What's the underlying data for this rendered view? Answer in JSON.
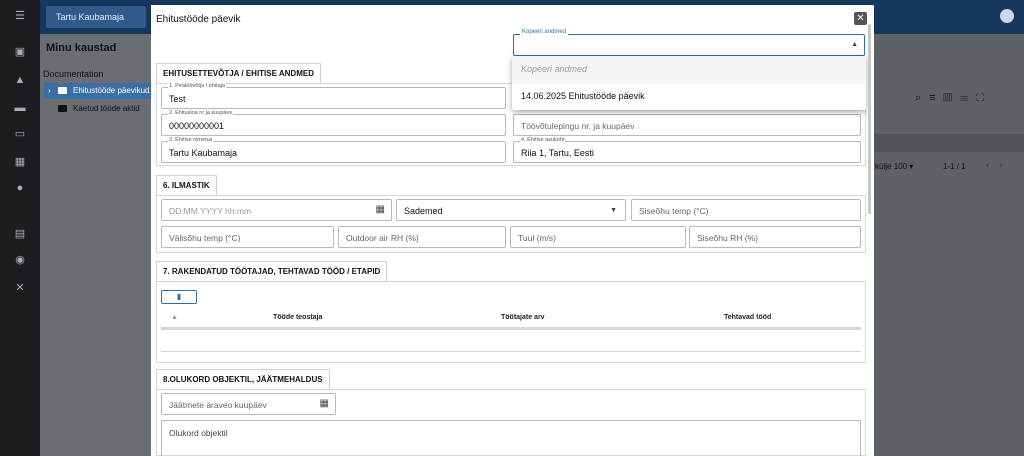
{
  "app": {
    "crumb": "Tartu Kaubamaja",
    "sidebar_icons": [
      "menu-icon",
      "dashboard-icon",
      "tools-icon",
      "folder-icon",
      "inbox-icon",
      "calculator-icon",
      "users-icon",
      "calendar-icon",
      "settings-icon",
      "wrench-icon"
    ]
  },
  "panel": {
    "title": "Minu kaustad",
    "section": "Documentation",
    "items": [
      {
        "label": "Ehitustööde päevikud",
        "active": true
      },
      {
        "label": "Kaetud tööde aktid",
        "active": false
      }
    ]
  },
  "background_grid": {
    "per_page_label": "külje",
    "per_page_value": "100 ▾",
    "range": "1-1 / 1"
  },
  "modal": {
    "title": "Ehitustööde päevik",
    "close_label": "✕",
    "copy": {
      "label": "Kopeeri andmed",
      "placeholder_option": "Kopeeri andmed",
      "options": [
        "14.06.2025 Ehitustööde päevik"
      ]
    },
    "section1": {
      "tab": "EHITUSETTEVÕTJA / EHITISE ANDMED",
      "fields": {
        "contractor": {
          "label": "1. Peatöövõtja / ehitaja",
          "value": "Test"
        },
        "contract_no": {
          "label": "2. Ehitusloa nr ja kuupäev",
          "value": "00000000001"
        },
        "work_contract": {
          "placeholder": "Töövõtulepingu nr. ja kuupäev"
        },
        "building_name": {
          "label": "3. Ehitise nimetus",
          "value": "Tartu Kaubamaja"
        },
        "building_location": {
          "label": "4. Ehitise asukoht",
          "value": "Riia 1, Tartu, Eesti"
        }
      }
    },
    "section6": {
      "tab": "6. ILMASTIK",
      "date_placeholder": "DD.MM.YYYY hh:mm",
      "precipitation": "Sademed",
      "indoor_temp": "Siseõhu temp (°C)",
      "outdoor_temp": "Välisõhu temp (°C)",
      "outdoor_rh": "Outdoor air RH (%)",
      "wind": "Tuul (m/s)",
      "indoor_rh": "Siseõhu RH (%)"
    },
    "section7": {
      "tab": "7. RAKENDATUD TÖÖTAJAD, TEHTAVAD TÖÖD / ETAPID",
      "columns": [
        "Tööde teostaja",
        "Töötajate arv",
        "Tehtavad tööd"
      ]
    },
    "section8": {
      "tab": "8.OLUKORD OBJEKTIL, JÄÄTMEHALDUS",
      "waste_date": "Jäätmete äraveo kuupäev",
      "situation": "Olukord objektil"
    }
  }
}
